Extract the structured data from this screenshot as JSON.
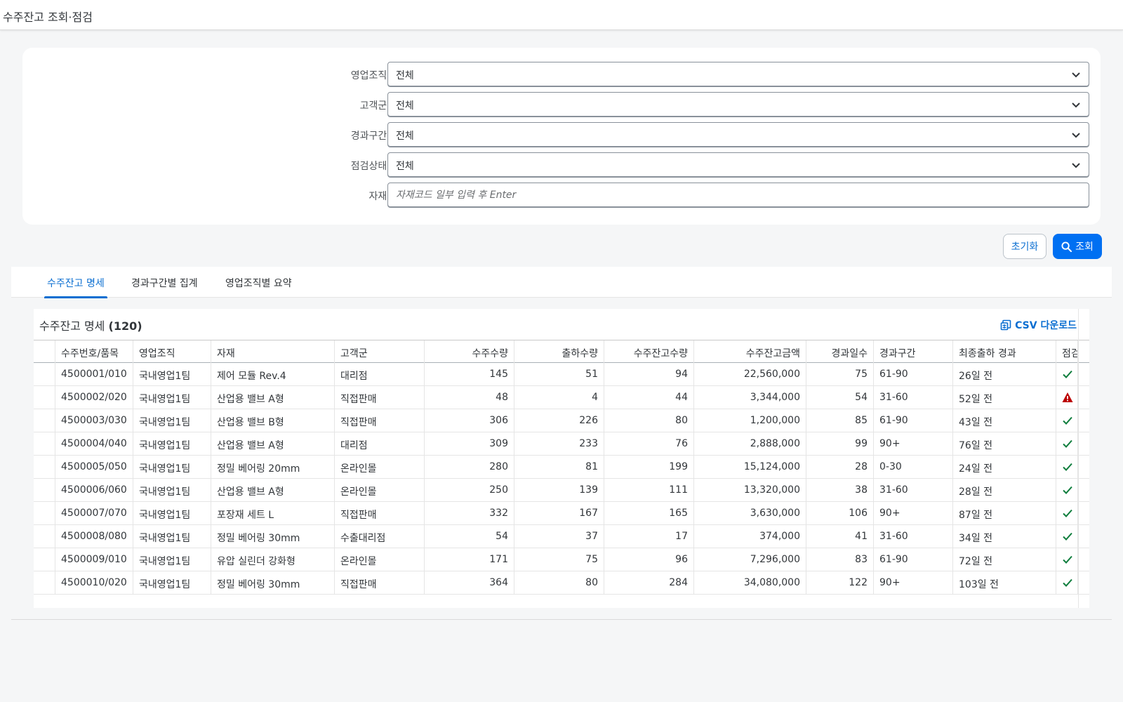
{
  "app": {
    "title": "수주잔고 조회·점검"
  },
  "filters": [
    {
      "label": "영업조직:",
      "value": "전체",
      "type": "select"
    },
    {
      "label": "고객군:",
      "value": "전체",
      "type": "select"
    },
    {
      "label": "경과구간:",
      "value": "전체",
      "type": "select"
    },
    {
      "label": "점검상태:",
      "value": "전체",
      "type": "select"
    },
    {
      "label": "자재:",
      "placeholder": "자재코드 일부 입력 후 Enter",
      "type": "input"
    }
  ],
  "actions": {
    "reset_label": "초기화",
    "search_label": "조회"
  },
  "tabs": [
    {
      "label": "수주잔고 명세",
      "active": true
    },
    {
      "label": "경과구간별 집계",
      "active": false
    },
    {
      "label": "영업조직별 요약",
      "active": false
    }
  ],
  "table": {
    "title": "수주잔고 명세",
    "count": "(120)",
    "csv_label": "CSV 다운로드",
    "columns": [
      "수주번호/품목",
      "영업조직",
      "자재",
      "고객군",
      "수주수량",
      "출하수량",
      "수주잔고수량",
      "수주잔고금액",
      "경과일수",
      "경과구간",
      "최종출하 경과",
      "점검"
    ],
    "rows": [
      [
        "4500001/010",
        "국내영업1팀",
        "제어 모듈 Rev.4",
        "대리점",
        "145",
        "51",
        "94",
        "22,560,000",
        "75",
        "61-90",
        "26일 전",
        "ok"
      ],
      [
        "4500002/020",
        "국내영업1팀",
        "산업용 밸브 A형",
        "직접판매",
        "48",
        "4",
        "44",
        "3,344,000",
        "54",
        "31-60",
        "52일 전",
        "warn"
      ],
      [
        "4500003/030",
        "국내영업1팀",
        "산업용 밸브 B형",
        "직접판매",
        "306",
        "226",
        "80",
        "1,200,000",
        "85",
        "61-90",
        "43일 전",
        "ok"
      ],
      [
        "4500004/040",
        "국내영업1팀",
        "산업용 밸브 A형",
        "대리점",
        "309",
        "233",
        "76",
        "2,888,000",
        "99",
        "90+",
        "76일 전",
        "ok"
      ],
      [
        "4500005/050",
        "국내영업1팀",
        "정밀 베어링 20mm",
        "온라인몰",
        "280",
        "81",
        "199",
        "15,124,000",
        "28",
        "0-30",
        "24일 전",
        "ok"
      ],
      [
        "4500006/060",
        "국내영업1팀",
        "산업용 밸브 A형",
        "온라인몰",
        "250",
        "139",
        "111",
        "13,320,000",
        "38",
        "31-60",
        "28일 전",
        "ok"
      ],
      [
        "4500007/070",
        "국내영업1팀",
        "포장재 세트 L",
        "직접판매",
        "332",
        "167",
        "165",
        "3,630,000",
        "106",
        "90+",
        "87일 전",
        "ok"
      ],
      [
        "4500008/080",
        "국내영업1팀",
        "정밀 베어링 30mm",
        "수출대리점",
        "54",
        "37",
        "17",
        "374,000",
        "41",
        "31-60",
        "34일 전",
        "ok"
      ],
      [
        "4500009/010",
        "국내영업1팀",
        "유압 실린더 강화형",
        "온라인몰",
        "171",
        "75",
        "96",
        "7,296,000",
        "83",
        "61-90",
        "72일 전",
        "ok"
      ],
      [
        "4500010/020",
        "국내영업1팀",
        "정밀 베어링 30mm",
        "직접판매",
        "364",
        "80",
        "284",
        "34,080,000",
        "122",
        "90+",
        "103일 전",
        "ok"
      ]
    ]
  },
  "colors": {
    "accent": "#0a6ed1",
    "primary_button": "#0070f2",
    "ok": "#107e3e",
    "warn": "#bb0000"
  },
  "icons": {
    "select": "chevron-down-icon",
    "search": "search-icon",
    "csv": "spreadsheet-icon",
    "ok": "checkmark-icon",
    "warn": "warning-icon"
  }
}
